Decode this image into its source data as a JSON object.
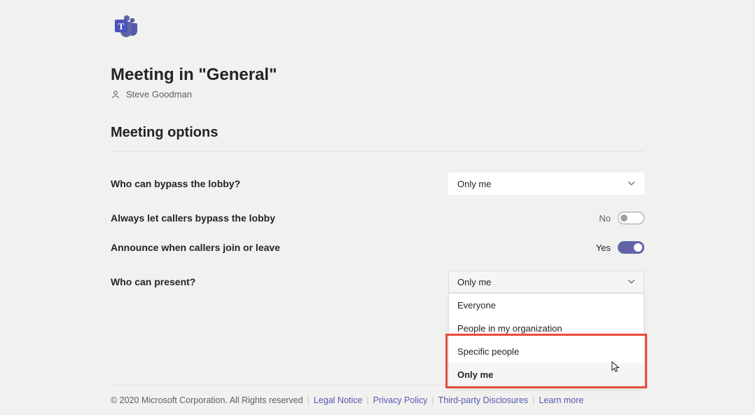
{
  "header": {
    "title": "Meeting in \"General\"",
    "organizer": "Steve Goodman"
  },
  "section": {
    "title": "Meeting options"
  },
  "options": {
    "bypass_lobby": {
      "label": "Who can bypass the lobby?",
      "value": "Only me"
    },
    "callers_bypass": {
      "label": "Always let callers bypass the lobby",
      "state_label": "No"
    },
    "announce": {
      "label": "Announce when callers join or leave",
      "state_label": "Yes"
    },
    "who_present": {
      "label": "Who can present?",
      "value": "Only me",
      "items": [
        "Everyone",
        "People in my organization",
        "Specific people",
        "Only me"
      ]
    }
  },
  "footer": {
    "copyright": "© 2020 Microsoft Corporation. All Rights reserved",
    "links": [
      "Legal Notice",
      "Privacy Policy",
      "Third-party Disclosures",
      "Learn more"
    ]
  }
}
